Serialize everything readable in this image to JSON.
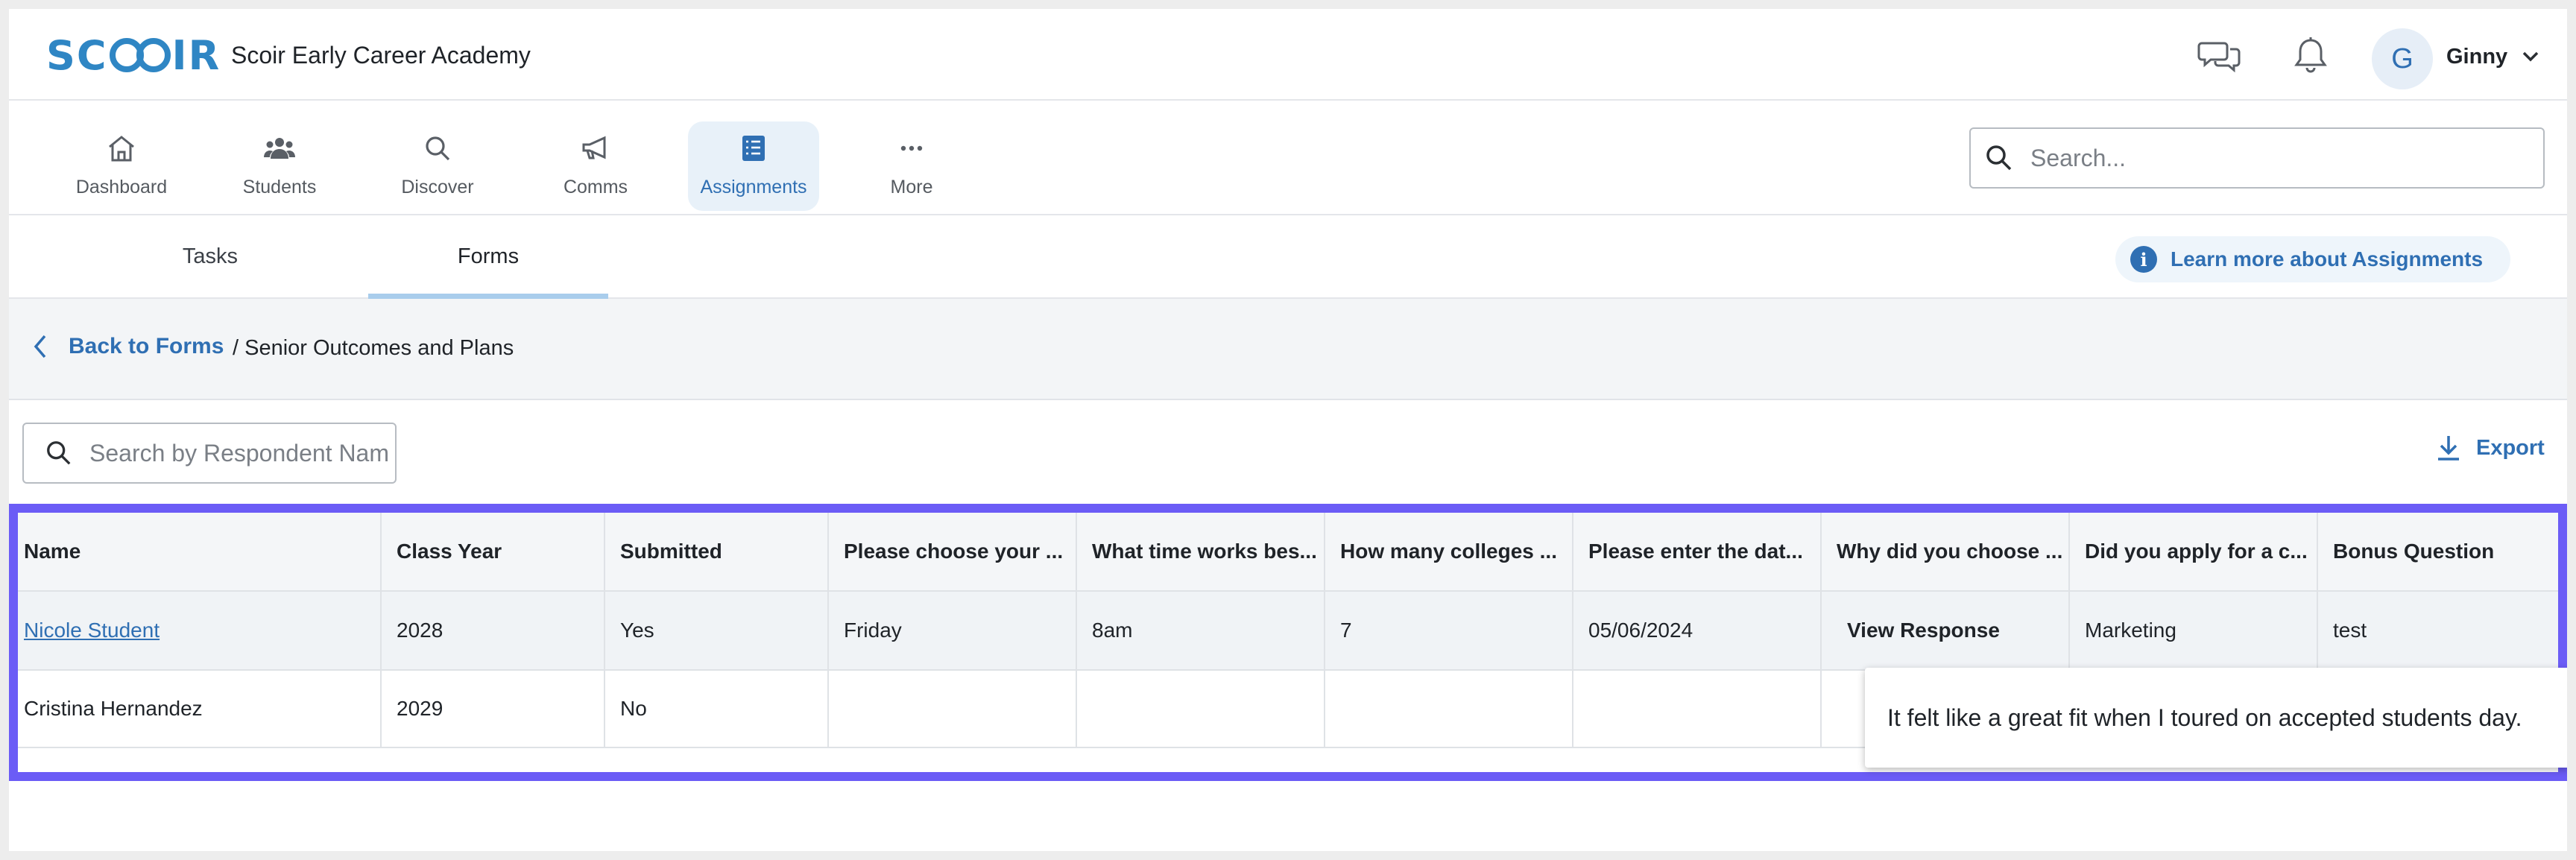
{
  "header": {
    "logo_text": "SCOIR",
    "app_title": "Scoir Early Career Academy",
    "avatar_initial": "G",
    "user_name": "Ginny"
  },
  "nav": {
    "items": [
      {
        "label": "Dashboard",
        "icon": "home-icon"
      },
      {
        "label": "Students",
        "icon": "users-icon"
      },
      {
        "label": "Discover",
        "icon": "search-icon"
      },
      {
        "label": "Comms",
        "icon": "megaphone-icon"
      },
      {
        "label": "Assignments",
        "icon": "list-icon",
        "active": true
      },
      {
        "label": "More",
        "icon": "more-icon"
      }
    ],
    "search_placeholder": "Search..."
  },
  "tabs": {
    "items": [
      {
        "label": "Tasks"
      },
      {
        "label": "Forms",
        "active": true
      }
    ],
    "learn_more": "Learn more about Assignments"
  },
  "breadcrumb": {
    "back_label": "Back to Forms",
    "current": "/ Senior Outcomes and Plans"
  },
  "filters": {
    "respondent_search_placeholder": "Search by Respondent Name",
    "export_label": "Export"
  },
  "table": {
    "columns": [
      "Name",
      "Class Year",
      "Submitted",
      "Please choose your ...",
      "What time works bes...",
      "How many colleges ...",
      "Please enter the dat...",
      "Why did you choose ...",
      "Did you apply for a c...",
      "Bonus Question"
    ],
    "rows": [
      [
        "Nicole Student",
        "2028",
        "Yes",
        "Friday",
        "8am",
        "7",
        "05/06/2024",
        "View Response",
        "Marketing",
        "test"
      ],
      [
        "Cristina Hernandez",
        "2029",
        "No",
        "",
        "",
        "",
        "",
        "",
        "",
        ""
      ]
    ]
  },
  "tooltip": {
    "text": "It felt like a great fit when I toured on accepted students day."
  },
  "colors": {
    "brand": "#2f86c4",
    "link": "#2f6fb3",
    "highlight_border": "#6b5cf6"
  }
}
